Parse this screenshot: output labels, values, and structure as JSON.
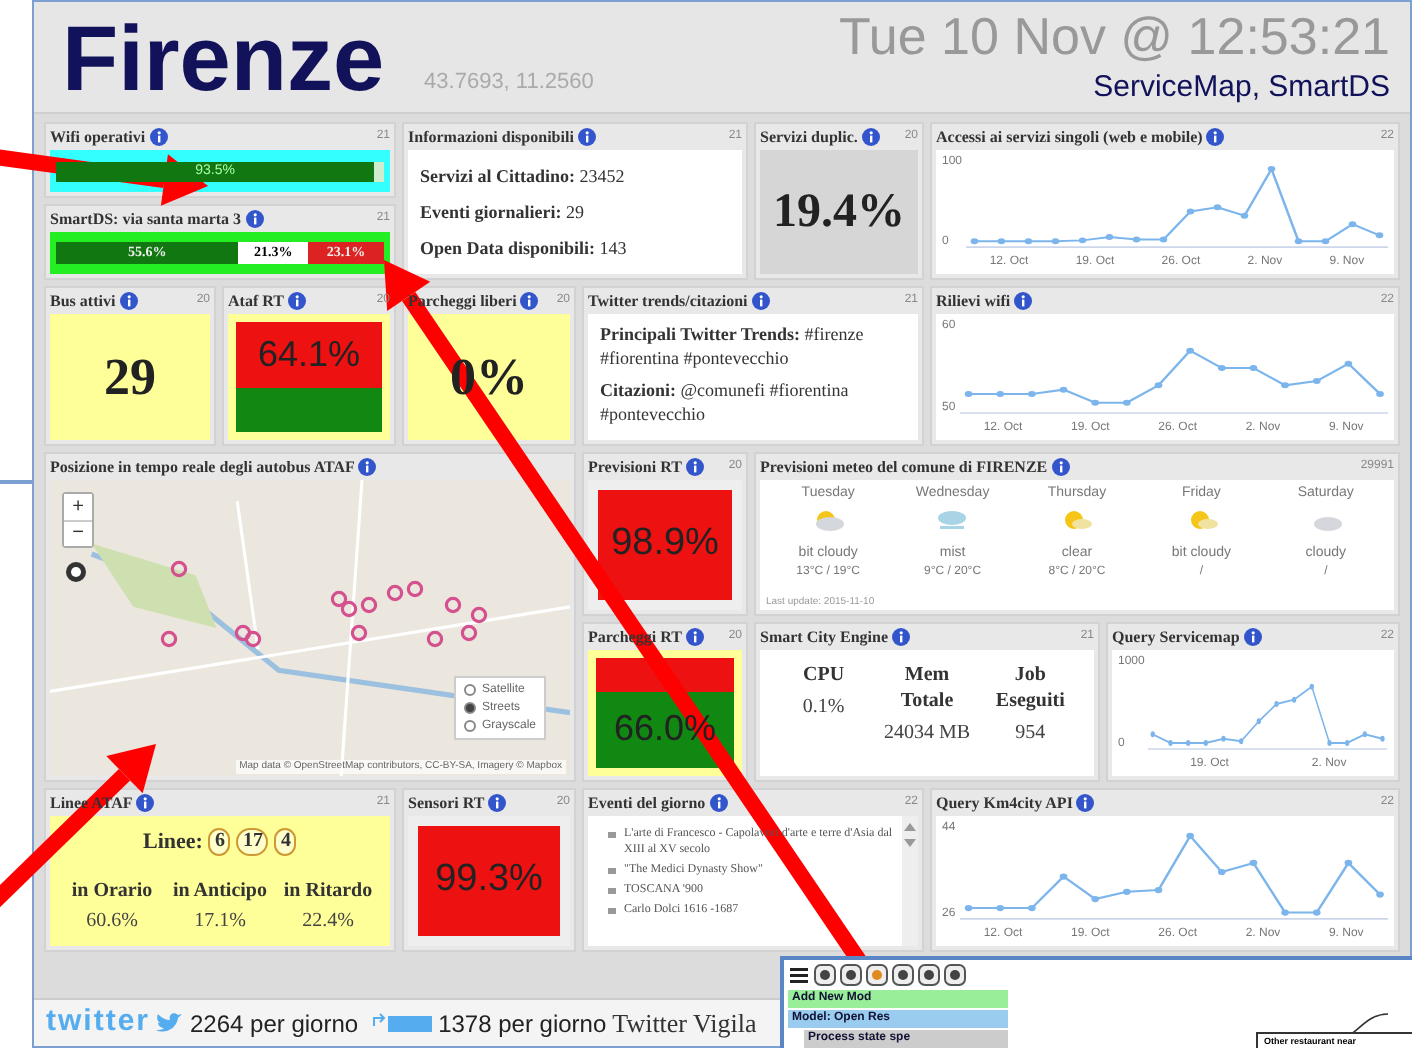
{
  "header": {
    "title": "Firenze",
    "coordinates": "43.7693, 11.2560",
    "datetime": "Tue 10 Nov @ 12:53:21",
    "sources": "ServiceMap, SmartDS"
  },
  "widgets": [
    {
      "kind": "bar",
      "title": "Wifi operativi",
      "count": "21",
      "value": "93.5%",
      "level": 0.97
    },
    {
      "kind": "segments",
      "title": "SmartDS: via santa marta 3",
      "count": "21",
      "segments": [
        {
          "value": "55.6%",
          "color": "#117711"
        },
        {
          "value": "21.3%",
          "color": "#ffffff"
        },
        {
          "value": "23.1%",
          "color": "#dd2222"
        }
      ]
    },
    {
      "kind": "info_list",
      "title": "Informazioni disponibili",
      "count": "21",
      "items": [
        "**Servizi al Cittadino:** 23452",
        "**Eventi giornalieri:** 29",
        "**Open Data disponibili:** 143"
      ]
    },
    {
      "kind": "plain_value",
      "title": "Servizi duplic.",
      "count": "20",
      "value": "19.4%"
    },
    {
      "kind": "line_chart",
      "title": "Accessi ai servizi singoli (web e mobile)",
      "count": "22",
      "y_labels": [
        "100",
        "0"
      ],
      "x_labels": [
        "12. Oct",
        "19. Oct",
        "26. Oct",
        "2. Nov",
        "9. Nov"
      ]
    },
    {
      "kind": "highlight_value",
      "title": "Bus attivi",
      "count": "20",
      "value": "29"
    },
    {
      "kind": "split_upper",
      "title": "Ataf RT",
      "count": "20",
      "value": "64.1%"
    },
    {
      "kind": "highlight_value",
      "title": "Parcheggi liberi",
      "count": "20",
      "value": "0%"
    },
    {
      "kind": "text_list",
      "title": "Twitter trends/citazioni",
      "count": "21",
      "items": [
        "**Principali Twitter Trends:** #firenze #fiorentina #pontevecchio",
        "**Citazioni:** @comunefi #fiorentina #pontevecchio"
      ]
    },
    {
      "kind": "line_chart",
      "title": "Rilievi wifi",
      "count": "22",
      "y_labels": [
        "60",
        "50"
      ],
      "x_labels": [
        "12. Oct",
        "19. Oct",
        "26. Oct",
        "2. Nov",
        "9. Nov"
      ]
    },
    {
      "kind": "map",
      "title": "Posizione in tempo reale degli autobus ATAF",
      "zoom_in": "+",
      "zoom_out": "−",
      "layers": [
        {
          "label": "Satellite",
          "selected": false
        },
        {
          "label": "Streets",
          "selected": true
        },
        {
          "label": "Grayscale",
          "selected": false
        }
      ],
      "attribution": "Map data © OpenStreetMap contributors, CC-BY-SA, Imagery © Mapbox"
    },
    {
      "kind": "alert_value",
      "title": "Previsioni RT",
      "count": "20",
      "value": "98.9%"
    },
    {
      "kind": "weather",
      "title": "Previsioni meteo del comune di FIRENZE",
      "count": "29991",
      "days": [
        {
          "day": "Tuesday",
          "kind": "partly",
          "condition": "bit cloudy",
          "temps": "13°C / 19°C"
        },
        {
          "day": "Wednesday",
          "kind": "mist",
          "condition": "mist",
          "temps": "9°C / 20°C"
        },
        {
          "day": "Thursday",
          "kind": "sun",
          "condition": "clear",
          "temps": "8°C / 20°C"
        },
        {
          "day": "Friday",
          "kind": "sun",
          "condition": "bit cloudy",
          "temps": "/"
        },
        {
          "day": "Saturday",
          "kind": "cloud",
          "condition": "cloudy",
          "temps": "/"
        }
      ],
      "footnote": "Last update: 2015-11-10"
    },
    {
      "kind": "split_lower",
      "title": "Parcheggi RT",
      "count": "20",
      "value": "66.0%"
    },
    {
      "kind": "engine",
      "title": "Smart City Engine",
      "count": "21",
      "columns": [
        {
          "head": "CPU",
          "value": "0.1%"
        },
        {
          "head": "Mem Totale",
          "value": "24034 MB"
        },
        {
          "head": "Job Eseguiti",
          "value": "954"
        }
      ]
    },
    {
      "kind": "line_chart",
      "title": "Query Servicemap",
      "count": "22",
      "y_labels": [
        "1000",
        "0"
      ],
      "x_labels": [
        "19. Oct",
        "2. Nov"
      ]
    },
    {
      "kind": "lines",
      "title": "Linee ATAF",
      "count": "21",
      "label": "Linee:",
      "numbers": [
        "6",
        "17",
        "4"
      ],
      "stats": [
        {
          "label": "in Orario",
          "value": "60.6%"
        },
        {
          "label": "in Anticipo",
          "value": "17.1%"
        },
        {
          "label": "in Ritardo",
          "value": "22.4%"
        }
      ]
    },
    {
      "kind": "alert_value",
      "title": "Sensori RT",
      "count": "20",
      "value": "99.3%"
    },
    {
      "kind": "events",
      "title": "Eventi del giorno",
      "count": "22",
      "items": [
        "L'arte di Francesco - Capolavori d'arte e terre d'Asia dal XIII al XV secolo",
        "\"The Medici Dynasty Show\"",
        "TOSCANA '900",
        "Carlo Dolci 1616 -1687"
      ]
    },
    {
      "kind": "line_chart",
      "title": "Query Km4city API",
      "count": "22",
      "y_labels": [
        "44",
        "26"
      ],
      "x_labels": [
        "12. Oct",
        "19. Oct",
        "26. Oct",
        "2. Nov",
        "9. Nov"
      ]
    }
  ],
  "footer": {
    "logo": "twitter",
    "daily_tweets": "2264 per giorno",
    "daily_retweets": "1378 per giorno",
    "link": "Twitter Vigila"
  },
  "editor": {
    "items": [
      {
        "label": "Add New Mod",
        "color": "#99ee99"
      },
      {
        "label": "Model: Open Res",
        "color": "#99ccee"
      },
      {
        "label": "Process state spe",
        "color": "#cccccc"
      }
    ],
    "node": "Other restaurant near"
  }
}
